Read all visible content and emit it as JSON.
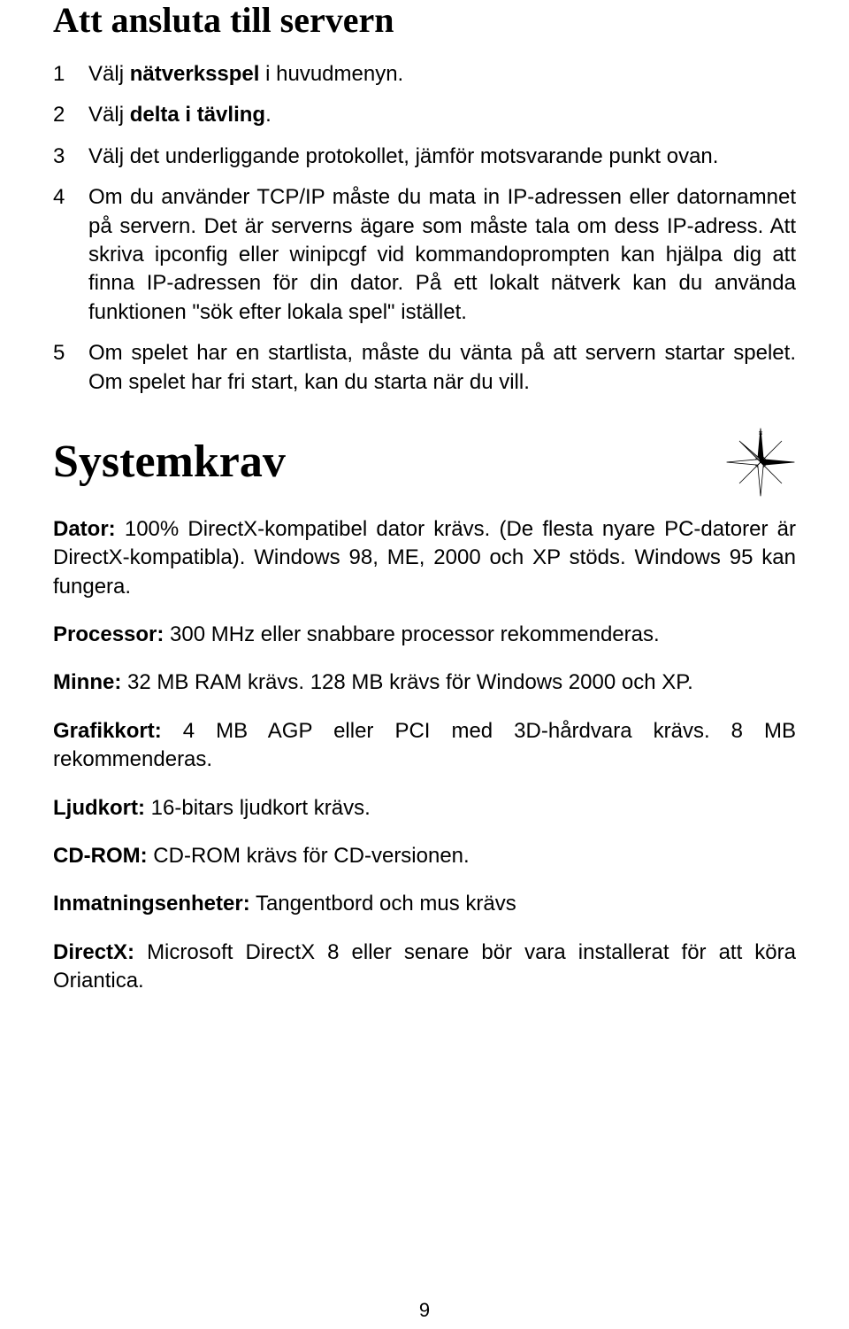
{
  "section1": {
    "heading": "Att ansluta till servern",
    "items": [
      {
        "n": "1",
        "pre": "Välj ",
        "bold": "nätverksspel",
        "post": " i huvudmenyn."
      },
      {
        "n": "2",
        "pre": "Välj ",
        "bold": "delta i tävling",
        "post": "."
      },
      {
        "n": "3",
        "full": "Välj det underliggande protokollet, jämför motsvarande punkt ovan."
      },
      {
        "n": "4",
        "full": "Om du använder TCP/IP måste du mata in IP-adressen eller datornamnet på servern. Det är serverns ägare som måste tala om dess IP-adress. Att skriva ipconfig eller winipcgf vid kommandoprompten kan hjälpa dig att finna IP-adressen för din dator. På ett lokalt nätverk kan du använda funktionen \"sök efter lokala spel\" istället."
      },
      {
        "n": "5",
        "full": "Om spelet har en startlista, måste du vänta på att servern startar spelet. Om spelet har fri start, kan du starta när du vill."
      }
    ]
  },
  "section2": {
    "heading": "Systemkrav",
    "reqs": [
      {
        "label": "Dator:",
        "text": " 100% DirectX-kompatibel dator krävs. (De flesta nyare PC-datorer är DirectX-kompatibla). Windows 98, ME, 2000 och XP stöds. Windows 95 kan fungera."
      },
      {
        "label": "Processor:",
        "text": " 300 MHz eller snabbare processor rekommenderas."
      },
      {
        "label": "Minne:",
        "text": " 32 MB RAM krävs. 128 MB krävs för Windows 2000 och XP."
      },
      {
        "label": "Grafikkort:",
        "text": " 4 MB AGP eller PCI med 3D-hårdvara krävs. 8 MB rekommenderas."
      },
      {
        "label": "Ljudkort:",
        "text": " 16-bitars ljudkort krävs."
      },
      {
        "label": "CD-ROM:",
        "text": " CD-ROM krävs för CD-versionen."
      },
      {
        "label": "Inmatningsenheter:",
        "text": " Tangentbord och mus krävs"
      },
      {
        "label": "DirectX:",
        "text": " Microsoft DirectX 8 eller senare bör vara installerat för att köra Oriantica."
      }
    ]
  },
  "pageNumber": "9"
}
